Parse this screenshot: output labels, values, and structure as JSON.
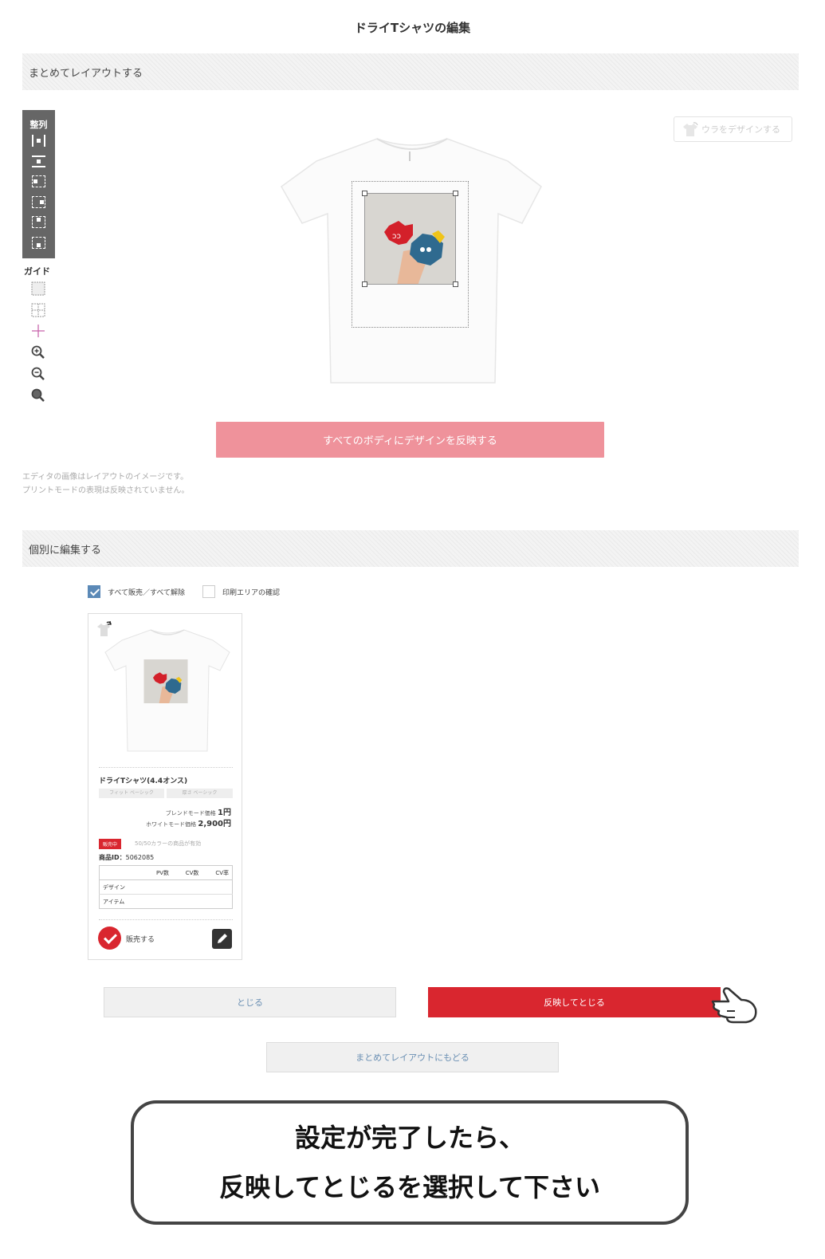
{
  "page": {
    "title": "ドライTシャツの編集"
  },
  "sections": {
    "bulk_layout": "まとめてレイアウトする",
    "individual_edit": "個別に編集する"
  },
  "toolbar": {
    "align_label": "整列",
    "guide_label": "ガイド"
  },
  "editor": {
    "back_design_label": "ウラをデザインする",
    "apply_all_label": "すべてのボディにデザインを反映する",
    "note_line1": "エディタの画像はレイアウトのイメージです。",
    "note_line2": "プリントモードの表現は反映されていません。"
  },
  "options": {
    "sell_all_label": "すべて販売／すべて解除",
    "print_area_label": "印刷エリアの確認",
    "sell_all_checked": true,
    "print_area_checked": false
  },
  "item": {
    "name": "ドライTシャツ(4.4オンス)",
    "tag_fit": "フィット ベーシック",
    "tag_thickness": "厚さ ベーシック",
    "blend_label": "ブレンドモード価格",
    "blend_price": "1円",
    "white_label": "ホワイトモード価格",
    "white_price": "2,900円",
    "status": "販売中",
    "availability": "50/50カラーの商品が有効",
    "id_label": "商品ID：",
    "id_value": "5062085",
    "stats_headers": [
      "",
      "PV数",
      "CV数",
      "CV率"
    ],
    "stats_rows": [
      [
        "デザイン",
        "",
        "",
        ""
      ],
      [
        "アイテム",
        "",
        "",
        ""
      ]
    ],
    "sell_label": "販売する"
  },
  "buttons": {
    "close": "とじる",
    "apply_close": "反映してとじる",
    "back_to_bulk": "まとめてレイアウトにもどる"
  },
  "callout": {
    "line1": "設定が完了したら、",
    "line2": "反映してとじるを選択して下さい"
  },
  "colors": {
    "accent_red": "#d9262f",
    "apply_all_pink": "#ef929b",
    "checkbox_blue": "#5b89b7",
    "link_blue": "#6a8fb3"
  }
}
